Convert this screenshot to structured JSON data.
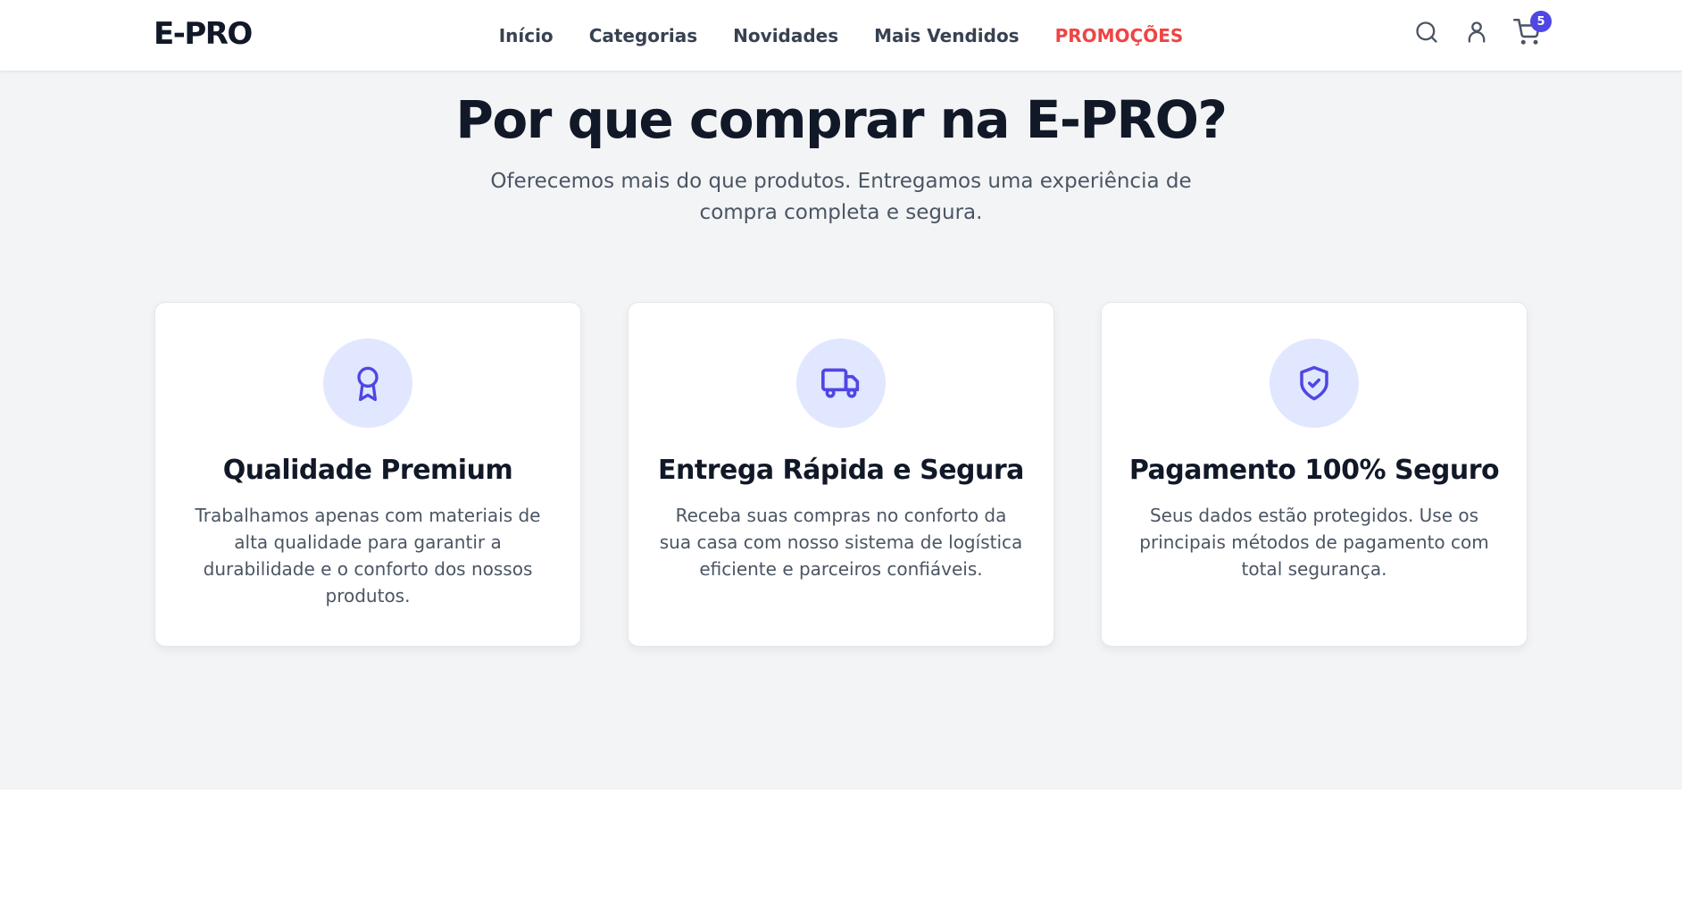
{
  "brand": {
    "logo": "E-PRO"
  },
  "nav": {
    "links": [
      "Início",
      "Categorias",
      "Novidades",
      "Mais Vendidos",
      "PROMOÇÕES"
    ],
    "promo_color": "#ef4444"
  },
  "header_icons": {
    "search": "search-icon",
    "user": "user-icon",
    "cart": "cart-icon",
    "cart_count": "5"
  },
  "section": {
    "title": "Por que comprar na E-PRO?",
    "subtitle": "Oferecemos mais do que produtos. Entregamos uma experiência de compra completa e segura."
  },
  "features": [
    {
      "icon": "award-icon",
      "title": "Qualidade Premium",
      "text": "Trabalhamos apenas com materiais de alta qualidade para garantir a durabilidade e o conforto dos nossos produtos."
    },
    {
      "icon": "truck-icon",
      "title": "Entrega Rápida e Segura",
      "text": "Receba suas compras no conforto da sua casa com nosso sistema de logística eficiente e parceiros confiáveis."
    },
    {
      "icon": "shield-check-icon",
      "title": "Pagamento 100% Seguro",
      "text": "Seus dados estão protegidos. Use os principais métodos de pagamento com total segurança."
    }
  ],
  "colors": {
    "accent": "#4f46e5",
    "icon_bg": "#e0e7ff",
    "section_bg": "#f3f4f6",
    "text_dark": "#111827",
    "text_muted": "#4b5563"
  }
}
